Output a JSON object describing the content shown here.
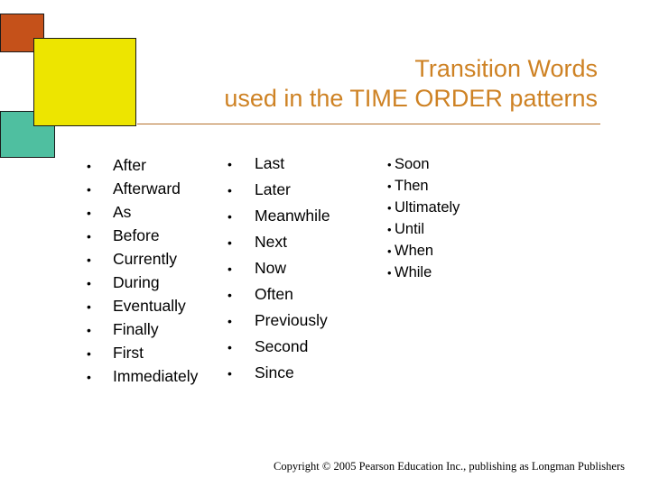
{
  "slide": {
    "title_lines": [
      "Transition Words",
      "used in the TIME ORDER patterns"
    ],
    "title_color": "#CE8224",
    "rule_color": "#B5712B",
    "background_color": "#FFFFFF",
    "decorations": [
      {
        "name": "orange-square",
        "color": "#C5511A"
      },
      {
        "name": "yellow-square",
        "color": "#EDE500"
      },
      {
        "name": "teal-square",
        "color": "#4FBFA0"
      }
    ],
    "columns": [
      {
        "name": "column-one",
        "bullet_glyph": "•",
        "items": [
          "After",
          "Afterward",
          "As",
          "Before",
          "Currently",
          "During",
          "Eventually",
          "Finally",
          "First",
          "Immediately"
        ]
      },
      {
        "name": "column-two",
        "bullet_glyph": "•",
        "items": [
          "Last",
          "Later",
          "Meanwhile",
          "Next",
          "Now",
          "Often",
          "Previously",
          "Second",
          "Since"
        ]
      },
      {
        "name": "column-three",
        "bullet_glyph": "•",
        "items": [
          "Soon",
          "Then",
          "Ultimately",
          "Until",
          "When",
          "While"
        ]
      }
    ],
    "copyright": "Copyright © 2005 Pearson Education Inc., publishing as Longman Publishers"
  }
}
